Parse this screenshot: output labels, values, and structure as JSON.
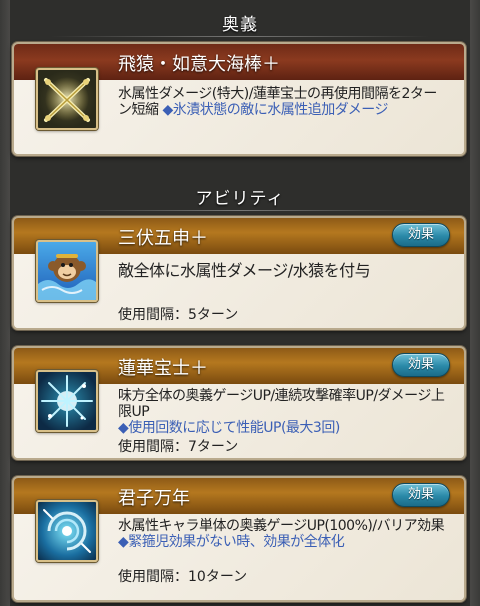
{
  "sections": {
    "ougi_title": "奥義",
    "ability_title": "アビリティ"
  },
  "ougi": {
    "name": "飛猿・如意大海棒＋",
    "icon": "crossed-staves-icon",
    "desc": "水属性ダメージ(特大)/蓮華宝士の再使用間隔を2ターン短縮",
    "note": "◆氷漬状態の敵に水属性追加ダメージ"
  },
  "abilities": [
    {
      "name": "三伏五申＋",
      "icon": "water-monkey-icon",
      "effect_label": "効果",
      "desc": "敵全体に水属性ダメージ/水猿を付与",
      "note": "",
      "cooldown": "使用間隔：5ターン"
    },
    {
      "name": "蓮華宝士＋",
      "icon": "sparkle-burst-icon",
      "effect_label": "効果",
      "desc": "味方全体の奥義ゲージUP/連続攻撃確率UP/ダメージ上限UP",
      "note": "◆使用回数に応じて性能UP(最大3回)",
      "cooldown": "使用間隔：7ターン"
    },
    {
      "name": "君子万年",
      "icon": "water-swirl-icon",
      "effect_label": "効果",
      "desc": "水属性キャラ単体の奥義ゲージUP(100%)/バリア効果",
      "note": "◆緊箍児効果がない時、効果が全体化",
      "cooldown": "使用間隔：10ターン"
    }
  ],
  "colors": {
    "ougi_header": "#8b3a1f",
    "ability_header": "#b5781f",
    "effect_button": "#2a89a8",
    "note_text": "#3b5fb5"
  }
}
